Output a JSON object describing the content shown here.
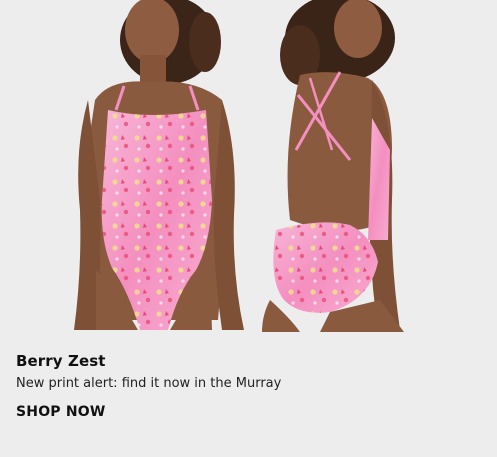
{
  "product": {
    "image_alt": "Two views of a pink printed one-piece swimsuit",
    "title": "Berry Zest",
    "subtitle": "New print alert: find it now in the Murray",
    "cta_label": "SHOP NOW"
  },
  "colors": {
    "background": "#ededed",
    "suit_pink": "#f59ac4",
    "skin": "#8a5a3f",
    "hair": "#3b2418"
  }
}
